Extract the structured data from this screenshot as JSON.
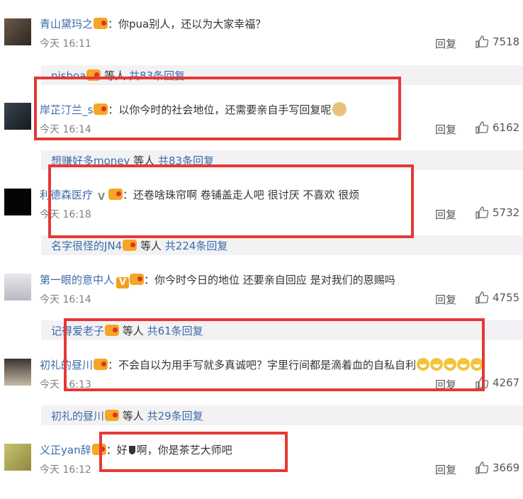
{
  "colors": {
    "accent_link": "#3d6aa8",
    "highlight_box": "#e53935",
    "sub_bg": "#f2f2f5",
    "meta": "#808080"
  },
  "labels": {
    "reply": "回复",
    "like_icon": "thumbs-up-icon"
  },
  "comments": [
    {
      "user": "青山黛玛之",
      "sep": "：",
      "text": "你pua别人，还以为大家幸福？",
      "time": "今天 16:11",
      "likes": "7518",
      "sub": {
        "user": "nisboa",
        "suffix": "等人",
        "count": "共83条回复"
      }
    },
    {
      "user": "岸芷汀兰_s",
      "sep": "：",
      "text": "以你今时的社会地位，还需要亲自手写回复呢",
      "time": "今天 16:14",
      "likes": "6162",
      "sub": {
        "user": "想赚好多money",
        "suffix": "等人",
        "count": "共83条回复"
      }
    },
    {
      "user": "利德森医疗",
      "sep": "：",
      "text": "还卷啥珠帘啊 卷铺盖走人吧 很讨厌 不喜欢 很烦",
      "time": "今天 16:18",
      "likes": "5732",
      "sub": {
        "user": "名字很怪的JN4",
        "suffix": "等人",
        "count": "共224条回复"
      }
    },
    {
      "user": "第一眼的意中人",
      "sep": "：",
      "text": "你今时今日的地位 还要亲自回应 是对我们的恩赐吗",
      "time": "今天 16:14",
      "likes": "4755",
      "sub": {
        "user": "记得爱老子",
        "suffix": "等人",
        "count": "共61条回复"
      }
    },
    {
      "user": "初礼的昼川",
      "sep": "：",
      "text": "不会自以为用手写就多真诚吧？字里行间都是滴着血的自私自利",
      "time": "今天 16:13",
      "likes": "4267",
      "sub": {
        "user": "初礼的昼川",
        "suffix": "等人",
        "count": "共29条回复"
      }
    },
    {
      "user": "义正yan辞",
      "sep": "：",
      "text_a": "好",
      "text_b": "啊，你是茶艺大师吧",
      "time": "今天 16:12",
      "likes": "3669"
    }
  ]
}
